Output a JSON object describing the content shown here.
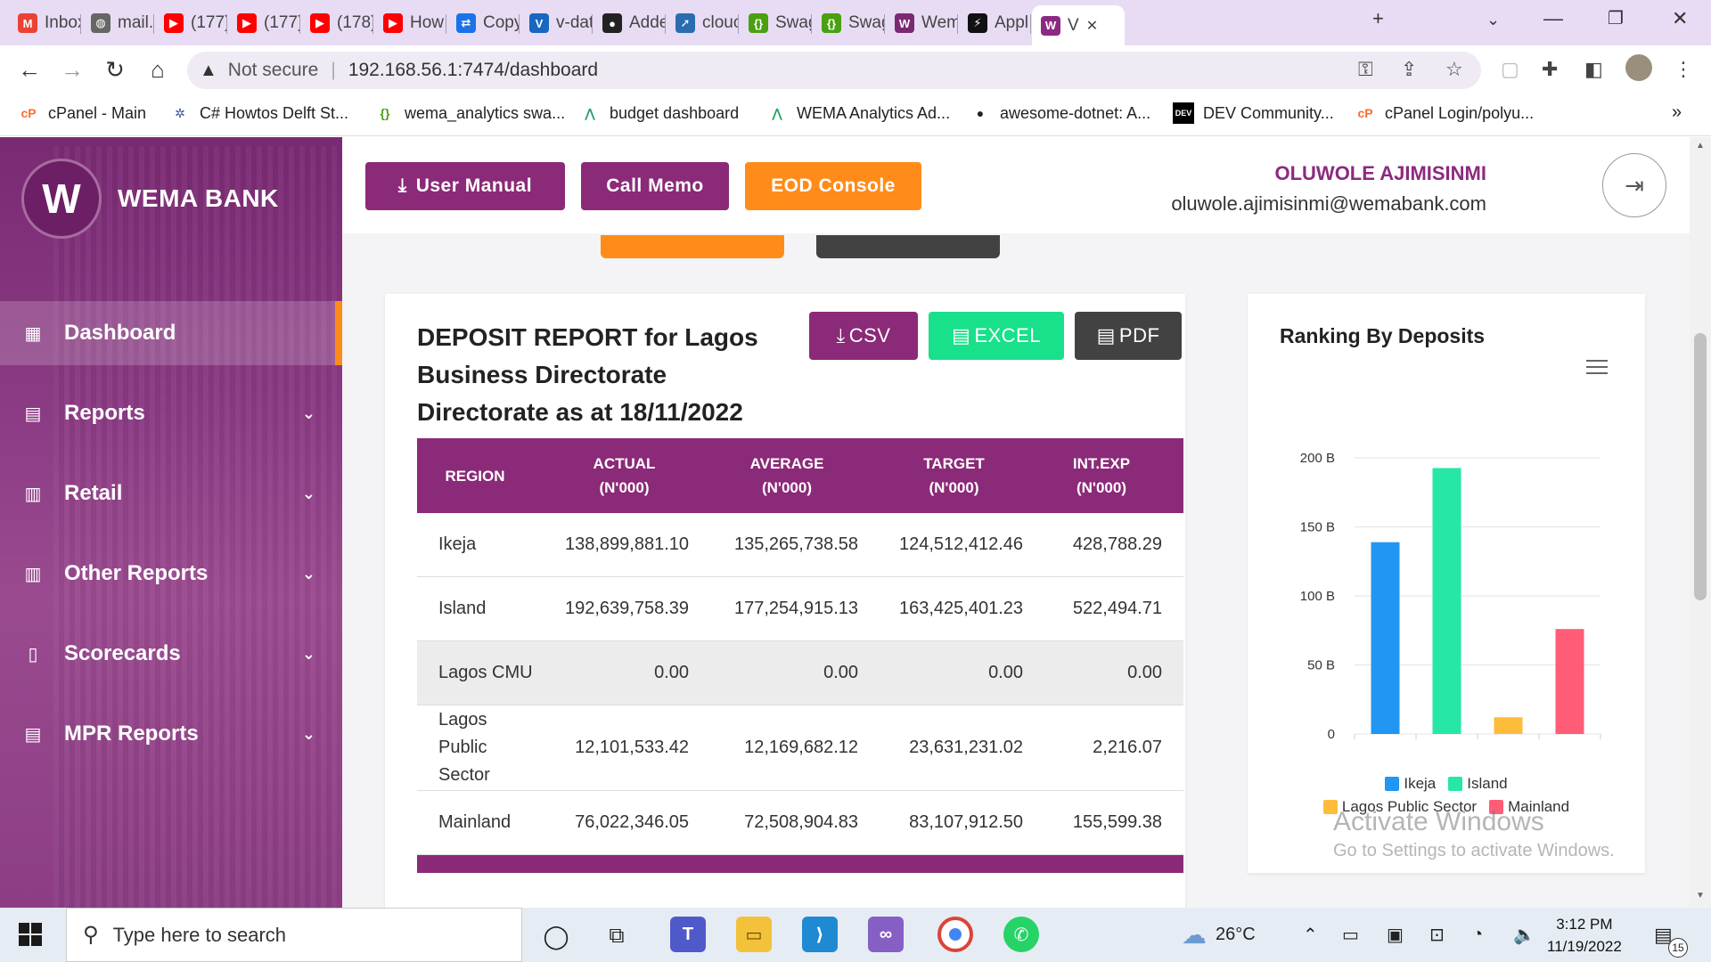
{
  "browser": {
    "tabs": [
      {
        "label": "Inbox",
        "icon": "gmail-icon",
        "color": "#ea4335",
        "glyph": "M"
      },
      {
        "label": "mail.",
        "icon": "globe-icon",
        "color": "#666666",
        "glyph": "◍"
      },
      {
        "label": "(177)",
        "icon": "youtube-icon",
        "color": "#ff0000",
        "glyph": "▶"
      },
      {
        "label": "(177)",
        "icon": "youtube-icon",
        "color": "#ff0000",
        "glyph": "▶"
      },
      {
        "label": "(178)",
        "icon": "youtube-icon",
        "color": "#ff0000",
        "glyph": "▶"
      },
      {
        "label": "How",
        "icon": "youtube-icon",
        "color": "#ff0000",
        "glyph": "▶"
      },
      {
        "label": "Copy",
        "icon": "share-icon",
        "color": "#1a73e8",
        "glyph": "⇄"
      },
      {
        "label": "v-dat",
        "icon": "vuetify-icon",
        "color": "#1867c0",
        "glyph": "V"
      },
      {
        "label": "Adde",
        "icon": "github-icon",
        "color": "#222222",
        "glyph": "●"
      },
      {
        "label": "clouc",
        "icon": "rocket-icon",
        "color": "#2b6cb0",
        "glyph": "➚"
      },
      {
        "label": "Swag",
        "icon": "swagger-icon",
        "color": "#49a010",
        "glyph": "{}"
      },
      {
        "label": "Swag",
        "icon": "swagger-icon",
        "color": "#49a010",
        "glyph": "{}"
      },
      {
        "label": "Wem",
        "icon": "wema-icon",
        "color": "#7a2a73",
        "glyph": "W"
      },
      {
        "label": "Appl",
        "icon": "app-icon",
        "color": "#111111",
        "glyph": "⚡"
      },
      {
        "label": "V",
        "icon": "wema-icon",
        "color": "#8b2a80",
        "glyph": "W"
      }
    ],
    "url_warning": "Not secure",
    "url": "192.168.56.1:7474/dashboard",
    "bookmarks": [
      {
        "label": "cPanel - Main",
        "icon": "cpanel-icon",
        "color": "#ff6c2c",
        "glyph": "cP"
      },
      {
        "label": "C# Howtos  Delft St...",
        "icon": "settings-icon",
        "color": "#3a5a99",
        "glyph": "✲"
      },
      {
        "label": "wema_analytics swa...",
        "icon": "swagger-icon",
        "color": "#49a010",
        "glyph": "{}"
      },
      {
        "label": "budget dashboard",
        "icon": "analytics-icon",
        "color": "#2aa36b",
        "glyph": "⋀"
      },
      {
        "label": "WEMA Analytics Ad...",
        "icon": "analytics-icon",
        "color": "#2aa36b",
        "glyph": "⋀"
      },
      {
        "label": "awesome-dotnet: A...",
        "icon": "github-icon",
        "color": "#222222",
        "glyph": "●"
      },
      {
        "label": "DEV Community...",
        "icon": "dev-icon",
        "color": "#000000",
        "glyph": "DEV"
      },
      {
        "label": "cPanel Login/polyu...",
        "icon": "cpanel-icon",
        "color": "#ff6c2c",
        "glyph": "cP"
      }
    ]
  },
  "sidebar": {
    "brand": "WEMA BANK",
    "items": [
      {
        "label": "Dashboard",
        "icon": "grid-icon",
        "active": true,
        "chevron": false
      },
      {
        "label": "Reports",
        "icon": "document-icon",
        "active": false,
        "chevron": true
      },
      {
        "label": "Retail",
        "icon": "bar-chart-icon",
        "active": false,
        "chevron": true
      },
      {
        "label": "Other Reports",
        "icon": "bar-chart-icon",
        "active": false,
        "chevron": true
      },
      {
        "label": "Scorecards",
        "icon": "scorecard-icon",
        "active": false,
        "chevron": true
      },
      {
        "label": "MPR Reports",
        "icon": "document-icon",
        "active": false,
        "chevron": true
      }
    ]
  },
  "topbar": {
    "user_manual": "User Manual",
    "call_memo": "Call Memo",
    "eod_console": "EOD Console",
    "user_name": "OLUWOLE AJIMISINMI",
    "user_email": "oluwole.ajimisinmi@wemabank.com"
  },
  "report": {
    "title": "DEPOSIT REPORT for Lagos Business Directorate Directorate as at 18/11/2022",
    "csv": "CSV",
    "excel": "EXCEL",
    "pdf": "PDF",
    "headers": [
      {
        "line1": "REGION",
        "line2": ""
      },
      {
        "line1": "ACTUAL",
        "line2": "(N'000)"
      },
      {
        "line1": "AVERAGE",
        "line2": "(N'000)"
      },
      {
        "line1": "TARGET",
        "line2": "(N'000)"
      },
      {
        "line1": "INT.EXP",
        "line2": "(N'000)"
      }
    ],
    "rows": [
      {
        "region": "Ikeja",
        "actual": "138,899,881.10",
        "average": "135,265,738.58",
        "target": "124,512,412.46",
        "intexp": "428,788.29"
      },
      {
        "region": "Island",
        "actual": "192,639,758.39",
        "average": "177,254,915.13",
        "target": "163,425,401.23",
        "intexp": "522,494.71"
      },
      {
        "region": "Lagos CMU",
        "actual": "0.00",
        "average": "0.00",
        "target": "0.00",
        "intexp": "0.00"
      },
      {
        "region": "Lagos Public Sector",
        "actual": "12,101,533.42",
        "average": "12,169,682.12",
        "target": "23,631,231.02",
        "intexp": "2,216.07"
      },
      {
        "region": "Mainland",
        "actual": "76,022,346.05",
        "average": "72,508,904.83",
        "target": "83,107,912.50",
        "intexp": "155,599.38"
      }
    ]
  },
  "chart_data": {
    "type": "bar",
    "title": "Ranking By Deposits",
    "categories": [
      "Ikeja",
      "Island",
      "Lagos Public Sector",
      "Mainland"
    ],
    "values": [
      138.9,
      192.6,
      12.1,
      76.0
    ],
    "colors": [
      "#2196f3",
      "#26e7a6",
      "#febc3b",
      "#ff5c77"
    ],
    "yticks": [
      "0",
      "50 B",
      "100 B",
      "150 B",
      "200 B"
    ],
    "ylim": [
      0,
      200
    ],
    "grid": true,
    "legend_position": "bottom"
  },
  "overlay": {
    "activate_title": "Activate Windows",
    "activate_sub": "Go to Settings to activate Windows."
  },
  "taskbar": {
    "search_placeholder": "Type here to search",
    "temperature": "26°C",
    "time": "3:12 PM",
    "date": "11/19/2022",
    "notifications": "15"
  }
}
